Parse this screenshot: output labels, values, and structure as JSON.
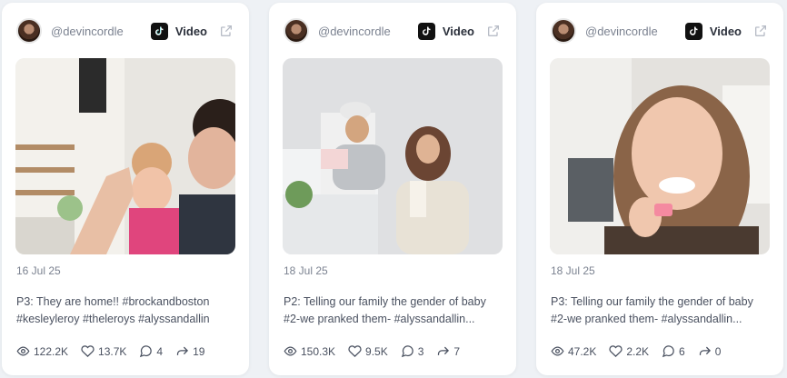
{
  "cards": [
    {
      "handle": "@devincordle",
      "platform": "Video",
      "platform_icon": "tiktok-icon",
      "date": "16 Jul 25",
      "caption_line1": "P3: They are home!! #brockandboston",
      "caption_line2": "#kesleyleroy #theleroys #alyssandallin",
      "views": "122.2K",
      "likes": "13.7K",
      "comments": "4",
      "shares": "19"
    },
    {
      "handle": "@devincordle",
      "platform": "Video",
      "platform_icon": "tiktok-icon",
      "date": "18 Jul 25",
      "caption_line1": "P2: Telling our family the gender of baby",
      "caption_line2": "#2-we pranked them- #alyssandallin...",
      "views": "150.3K",
      "likes": "9.5K",
      "comments": "3",
      "shares": "7"
    },
    {
      "handle": "@devincordle",
      "platform": "Video",
      "platform_icon": "tiktok-icon",
      "date": "18 Jul 25",
      "caption_line1": "P3: Telling our family the gender of baby",
      "caption_line2": "#2-we pranked them- #alyssandallin...",
      "views": "47.2K",
      "likes": "2.2K",
      "comments": "6",
      "shares": "0"
    }
  ],
  "colors": {
    "background": "#eef1f5",
    "card": "#ffffff",
    "text": "#4a5160",
    "muted": "#7b8290"
  }
}
